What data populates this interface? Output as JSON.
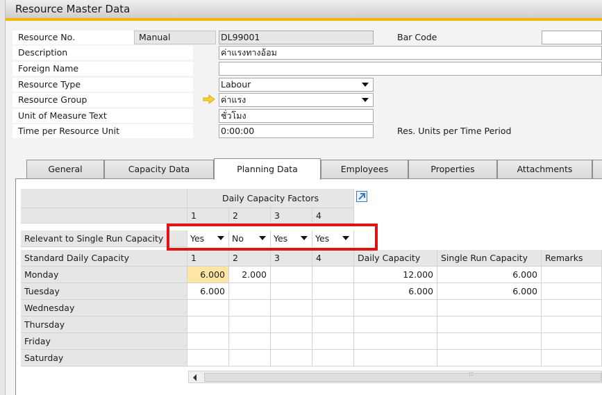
{
  "window": {
    "title": "Resource Master Data"
  },
  "form": {
    "resource_no": {
      "label": "Resource No.",
      "series": "Manual",
      "value": "DL99001"
    },
    "bar_code": {
      "label": "Bar Code",
      "value": ""
    },
    "description": {
      "label": "Description",
      "value": "ค่าแรงทางอ้อม"
    },
    "foreign_name": {
      "label": "Foreign Name",
      "value": ""
    },
    "resource_type": {
      "label": "Resource Type",
      "value": "Labour"
    },
    "resource_group": {
      "label": "Resource Group",
      "value": "ค่าแรง"
    },
    "uom_text": {
      "label": "Unit of Measure Text",
      "value": "ชั่วโมง"
    },
    "time_per_unit": {
      "label": "Time per Resource Unit",
      "value": "0:00:00"
    },
    "res_units_label": "Res. Units per Time Period"
  },
  "tabs": [
    {
      "label": "General"
    },
    {
      "label": "Capacity Data"
    },
    {
      "label": "Planning Data"
    },
    {
      "label": "Employees"
    },
    {
      "label": "Properties"
    },
    {
      "label": "Attachments"
    }
  ],
  "planning": {
    "factors_header": "Daily Capacity Factors",
    "factor_cols": [
      "1",
      "2",
      "3",
      "4"
    ],
    "relevant_label": "Relevant to Single Run Capacity",
    "relevant_values": [
      "Yes",
      "No",
      "Yes",
      "Yes"
    ],
    "columns": {
      "standard": "Standard Daily Capacity",
      "c1": "1",
      "c2": "2",
      "c3": "3",
      "c4": "4",
      "daily": "Daily Capacity",
      "single": "Single Run Capacity",
      "remarks": "Remarks"
    },
    "rows": [
      {
        "day": "Monday",
        "c1": "6.000",
        "c2": "2.000",
        "c3": "",
        "c4": "",
        "daily": "12.000",
        "single": "6.000",
        "remarks": ""
      },
      {
        "day": "Tuesday",
        "c1": "6.000",
        "c2": "",
        "c3": "",
        "c4": "",
        "daily": "6.000",
        "single": "6.000",
        "remarks": ""
      },
      {
        "day": "Wednesday",
        "c1": "",
        "c2": "",
        "c3": "",
        "c4": "",
        "daily": "",
        "single": "",
        "remarks": ""
      },
      {
        "day": "Thursday",
        "c1": "",
        "c2": "",
        "c3": "",
        "c4": "",
        "daily": "",
        "single": "",
        "remarks": ""
      },
      {
        "day": "Friday",
        "c1": "",
        "c2": "",
        "c3": "",
        "c4": "",
        "daily": "",
        "single": "",
        "remarks": ""
      },
      {
        "day": "Saturday",
        "c1": "",
        "c2": "",
        "c3": "",
        "c4": "",
        "daily": "",
        "single": "",
        "remarks": ""
      }
    ]
  },
  "colors": {
    "accent": "#f2b800",
    "highlight_box": "#e01414",
    "selected_cell": "#fde6a3"
  }
}
